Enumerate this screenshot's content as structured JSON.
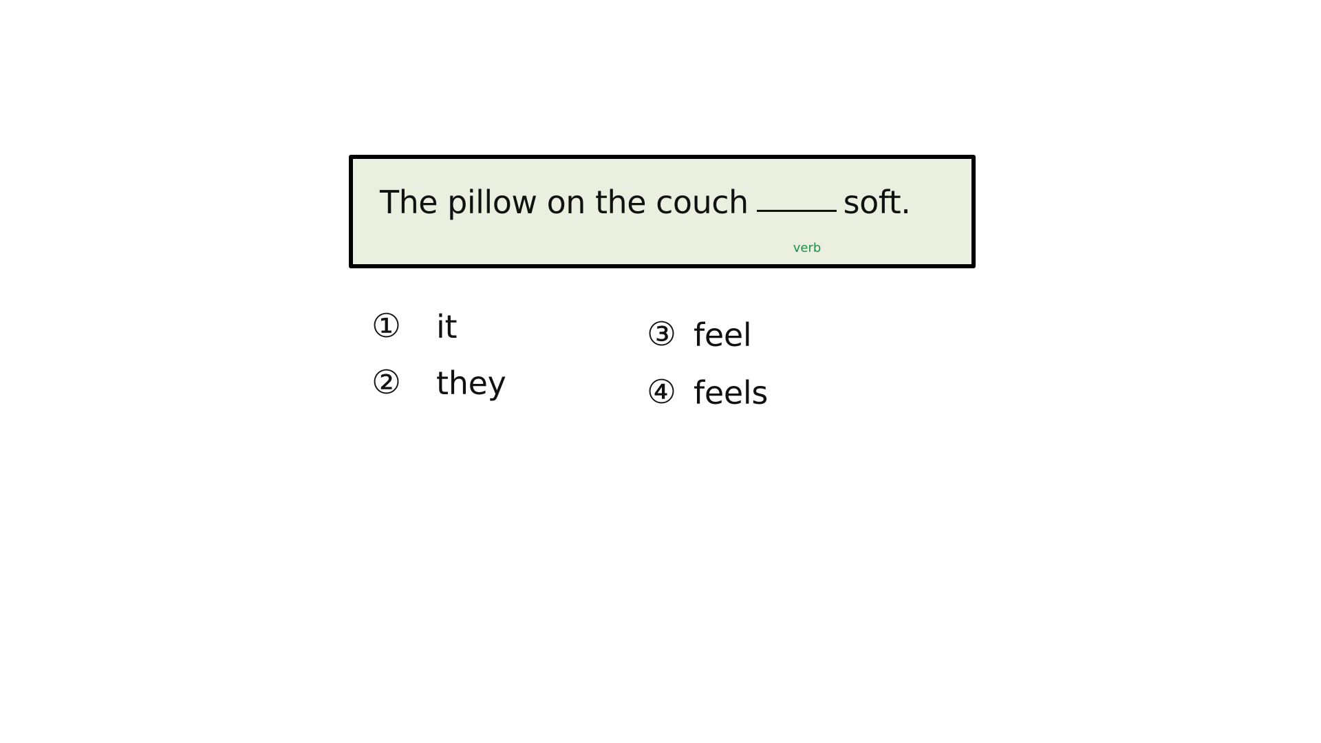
{
  "question": {
    "sentence_before": "The pillow on the couch",
    "sentence_after": "soft.",
    "blank_hint": "verb",
    "hint_color": "#1a8f4a",
    "box_background": "#ebefdf"
  },
  "options": [
    {
      "number": "①",
      "word": "it"
    },
    {
      "number": "②",
      "word": "they"
    },
    {
      "number": "③",
      "word": "feel"
    },
    {
      "number": "④",
      "word": "feels"
    }
  ]
}
